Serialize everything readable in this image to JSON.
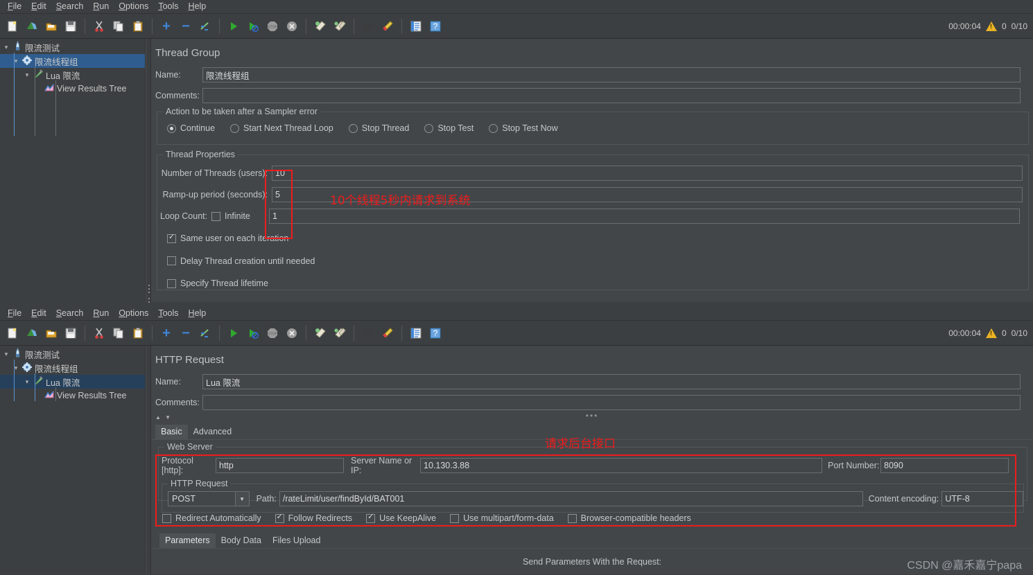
{
  "window": {
    "menu": [
      "File",
      "Edit",
      "Search",
      "Run",
      "Options",
      "Tools",
      "Help"
    ],
    "toolbar_icons": [
      "new-document-icon",
      "open-template-icon",
      "open-folder-icon",
      "save-icon",
      "cut-icon",
      "copy-icon",
      "paste-icon",
      "expand-all-icon",
      "collapse-all-icon",
      "toggle-icon",
      "start-icon",
      "start-no-pauses-icon",
      "stop-icon",
      "shutdown-icon",
      "clear-icon",
      "clear-all-icon",
      "search-icon",
      "search-reset-icon",
      "function-helper-icon",
      "help-icon"
    ],
    "status": {
      "elapsed": "00:00:04",
      "warnings": "0",
      "threads": "0/10"
    },
    "watermark": "CSDN @嘉禾嘉宁papa"
  },
  "top": {
    "tree": [
      {
        "label": "限流测试",
        "icon": "test-plan-icon",
        "indent": 0,
        "twist": "▾",
        "selected": false
      },
      {
        "label": "限流线程组",
        "icon": "thread-group-icon",
        "indent": 1,
        "twist": "▾",
        "selected": true
      },
      {
        "label": "Lua 限流",
        "icon": "http-sampler-icon",
        "indent": 2,
        "twist": "▾",
        "selected": false
      },
      {
        "label": "View Results Tree",
        "icon": "results-tree-icon",
        "indent": 3,
        "twist": "",
        "selected": false
      }
    ],
    "panel": {
      "title": "Thread Group",
      "name_label": "Name:",
      "name_value": "限流线程组",
      "comments_label": "Comments:",
      "comments_value": "",
      "sampler_error_legend": "Action to be taken after a Sampler error",
      "sampler_error_options": [
        {
          "label": "Continue",
          "selected": true
        },
        {
          "label": "Start Next Thread Loop",
          "selected": false
        },
        {
          "label": "Stop Thread",
          "selected": false
        },
        {
          "label": "Stop Test",
          "selected": false
        },
        {
          "label": "Stop Test Now",
          "selected": false
        }
      ],
      "thread_properties_legend": "Thread Properties",
      "num_threads_label": "Number of Threads (users):",
      "num_threads_value": "10",
      "rampup_label": "Ramp-up period (seconds):",
      "rampup_value": "5",
      "loop_count_label": "Loop Count:",
      "loop_infinite_label": "Infinite",
      "loop_infinite_checked": false,
      "loop_count_value": "1",
      "checkboxes": [
        {
          "label": "Same user on each iteration",
          "checked": true
        },
        {
          "label": "Delay Thread creation until needed",
          "checked": false
        },
        {
          "label": "Specify Thread lifetime",
          "checked": false
        }
      ],
      "annotation": "10个线程5秒内请求到系统"
    }
  },
  "bottom": {
    "tree": [
      {
        "label": "限流测试",
        "icon": "test-plan-icon",
        "indent": 0,
        "twist": "▾",
        "selected": false
      },
      {
        "label": "限流线程组",
        "icon": "thread-group-icon",
        "indent": 1,
        "twist": "▾",
        "selected": false
      },
      {
        "label": "Lua 限流",
        "icon": "http-sampler-icon",
        "indent": 2,
        "twist": "▾",
        "selected": true
      },
      {
        "label": "View Results Tree",
        "icon": "results-tree-icon",
        "indent": 3,
        "twist": "",
        "selected": false
      }
    ],
    "panel": {
      "title": "HTTP Request",
      "name_label": "Name:",
      "name_value": "Lua 限流",
      "comments_label": "Comments:",
      "comments_value": "",
      "tabs": [
        {
          "label": "Basic",
          "active": true
        },
        {
          "label": "Advanced",
          "active": false
        }
      ],
      "web_server_legend": "Web Server",
      "protocol_label": "Protocol [http]:",
      "protocol_value": "http",
      "server_label": "Server Name or IP:",
      "server_value": "10.130.3.88",
      "port_label": "Port Number:",
      "port_value": "8090",
      "http_request_legend": "HTTP Request",
      "method_value": "POST",
      "path_label": "Path:",
      "path_value": "/rateLimit/user/findById/BAT001",
      "encoding_label": "Content encoding:",
      "encoding_value": "UTF-8",
      "option_checkboxes": [
        {
          "label": "Redirect Automatically",
          "checked": false
        },
        {
          "label": "Follow Redirects",
          "checked": true
        },
        {
          "label": "Use KeepAlive",
          "checked": true
        },
        {
          "label": "Use multipart/form-data",
          "checked": false
        },
        {
          "label": "Browser-compatible headers",
          "checked": false
        }
      ],
      "param_tabs": [
        {
          "label": "Parameters",
          "active": true
        },
        {
          "label": "Body Data",
          "active": false
        },
        {
          "label": "Files Upload",
          "active": false
        }
      ],
      "send_params_label": "Send Parameters With the Request:",
      "annotation": "请求后台接口"
    }
  },
  "colors": {
    "background": "#3c3f41",
    "panel": "#434649",
    "selection": "#2f5d8f",
    "annotation_red": "#ee1c1c",
    "warning_yellow": "#e9b224"
  }
}
